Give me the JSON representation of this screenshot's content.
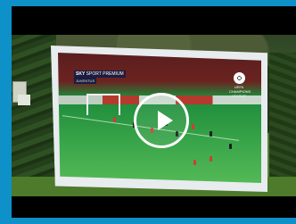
{
  "video": {
    "channel_label": "SPORT PREMIUM",
    "channel_brand": "SKY",
    "match_info": "JUVENTUS",
    "ucl_label": "UEFA CHAMPIONS LEAGUE",
    "accent_color": "#0e90c8"
  },
  "controls": {
    "play_icon": "play-icon"
  }
}
